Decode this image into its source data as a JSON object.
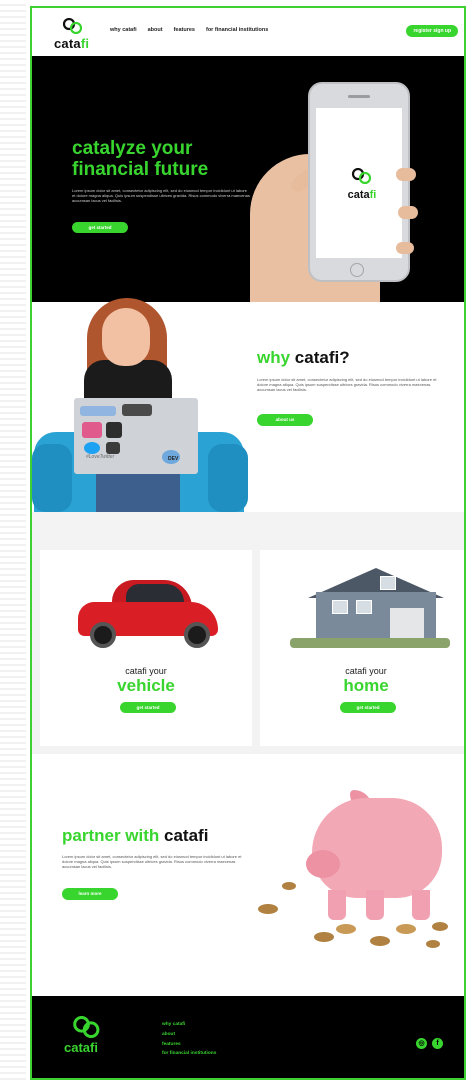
{
  "brand": {
    "name_part1": "cata",
    "name_part2": "fi",
    "accent_color": "#39d52f"
  },
  "nav": {
    "links": [
      "why catafi",
      "about",
      "features",
      "for financial institutions"
    ],
    "cta_label": "register sign up"
  },
  "hero": {
    "title": "catalyze your financial future",
    "body": "Lorem ipsum dolor sit amet, consectetur adipiscing elit, sed do eiusmod tempor incididunt ut labore et dolore magna aliqua. Quis ipsum suspendisse ultrices gravida. Risus commodo viverra maecenas accumsan lacus vel facilisis.",
    "button_label": "get started"
  },
  "why": {
    "title_part1": "why ",
    "title_part2": "catafi?",
    "body": "Lorem ipsum dolor sit amet, consectetur adipiscing elit, sed do eiusmod tempor incididunt ut labore et dolore magna aliqua. Quis ipsum suspendisse ultrices gravida. Risus commodo viverra maecenas accumsan lacus vel facilisis.",
    "button_label": "about us",
    "laptop_stickers": [
      "#LoveTwitter",
      "DEV"
    ]
  },
  "cards": [
    {
      "label": "catafi your",
      "big": "vehicle",
      "button_label": "get started"
    },
    {
      "label": "catafi your",
      "big": "home",
      "button_label": "get started"
    }
  ],
  "partner": {
    "title_part1": "partner with ",
    "title_part2": "catafi",
    "body": "Lorem ipsum dolor sit amet, consectetur adipiscing elit, sed do eiusmod tempor incididunt ut labore et dolore magna aliqua. Quis ipsum suspendisse ultrices gravida. Risus commodo viverra maecenas accumsan lacus vel facilisis.",
    "button_label": "learn more"
  },
  "footer": {
    "links": [
      "why catafi",
      "about",
      "features",
      "for financial institutions"
    ],
    "social": [
      {
        "icon": "instagram-icon",
        "glyph": "◎"
      },
      {
        "icon": "facebook-icon",
        "glyph": "f"
      }
    ]
  }
}
